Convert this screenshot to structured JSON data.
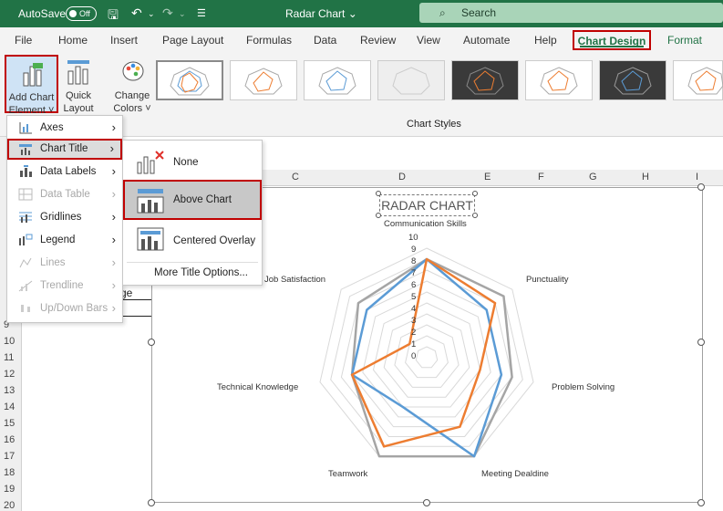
{
  "titlebar": {
    "autosave_label": "AutoSave",
    "toggle_state": "Off",
    "doc_title": "Radar Chart ⌄",
    "search_placeholder": "Search"
  },
  "tabs": [
    "File",
    "Home",
    "Insert",
    "Page Layout",
    "Formulas",
    "Data",
    "Review",
    "View",
    "Automate",
    "Help",
    "Chart Design",
    "Format"
  ],
  "ribbon": {
    "add_chart_element": "Add Chart Element ˅",
    "quick_layout": "Quick Layout ˅",
    "change_colors": "Change Colors ˅",
    "chart_styles": "Chart Styles"
  },
  "add_chart_menu": [
    {
      "label": "Axes",
      "enabled": true
    },
    {
      "label": "Chart Title",
      "enabled": true
    },
    {
      "label": "Data Labels",
      "enabled": true
    },
    {
      "label": "Data Table",
      "enabled": false
    },
    {
      "label": "Gridlines",
      "enabled": true
    },
    {
      "label": "Legend",
      "enabled": true
    },
    {
      "label": "Lines",
      "enabled": false
    },
    {
      "label": "Trendline",
      "enabled": false
    },
    {
      "label": "Up/Down Bars",
      "enabled": false
    }
  ],
  "chart_title_submenu": {
    "none": "None",
    "above_chart": "Above Chart",
    "centered_overlay": "Centered Overlay",
    "more_options": "More Title Options..."
  },
  "sheet": {
    "columns": [
      "C",
      "D",
      "E",
      "F",
      "G",
      "H",
      "I"
    ],
    "rows": [
      "9",
      "10",
      "11",
      "12",
      "13",
      "14",
      "15",
      "16",
      "17",
      "18",
      "19",
      "20"
    ],
    "cell_fragment": "ge"
  },
  "chart_data": {
    "type": "radar",
    "title": "RADAR CHART",
    "categories": [
      "Communication Skills",
      "Punctuality",
      "Problem Solving",
      "Meeting Dealdine",
      "Teamwork",
      "Technical Knowledge",
      "Job Satisfaction"
    ],
    "rlim": [
      0,
      10
    ],
    "ticks": [
      "10",
      "9",
      "8",
      "7",
      "6",
      "5",
      "4",
      "3",
      "2",
      "1",
      "0"
    ],
    "series": [
      {
        "color": "#5b9bd5",
        "values": [
          9,
          7,
          7,
          10,
          5,
          7,
          7
        ]
      },
      {
        "color": "#ed7d31",
        "values": [
          9,
          8,
          5,
          7,
          9,
          7,
          2
        ]
      },
      {
        "color": "#a5a5a5",
        "values": [
          9,
          9,
          8,
          10,
          10,
          7,
          8
        ]
      }
    ]
  }
}
